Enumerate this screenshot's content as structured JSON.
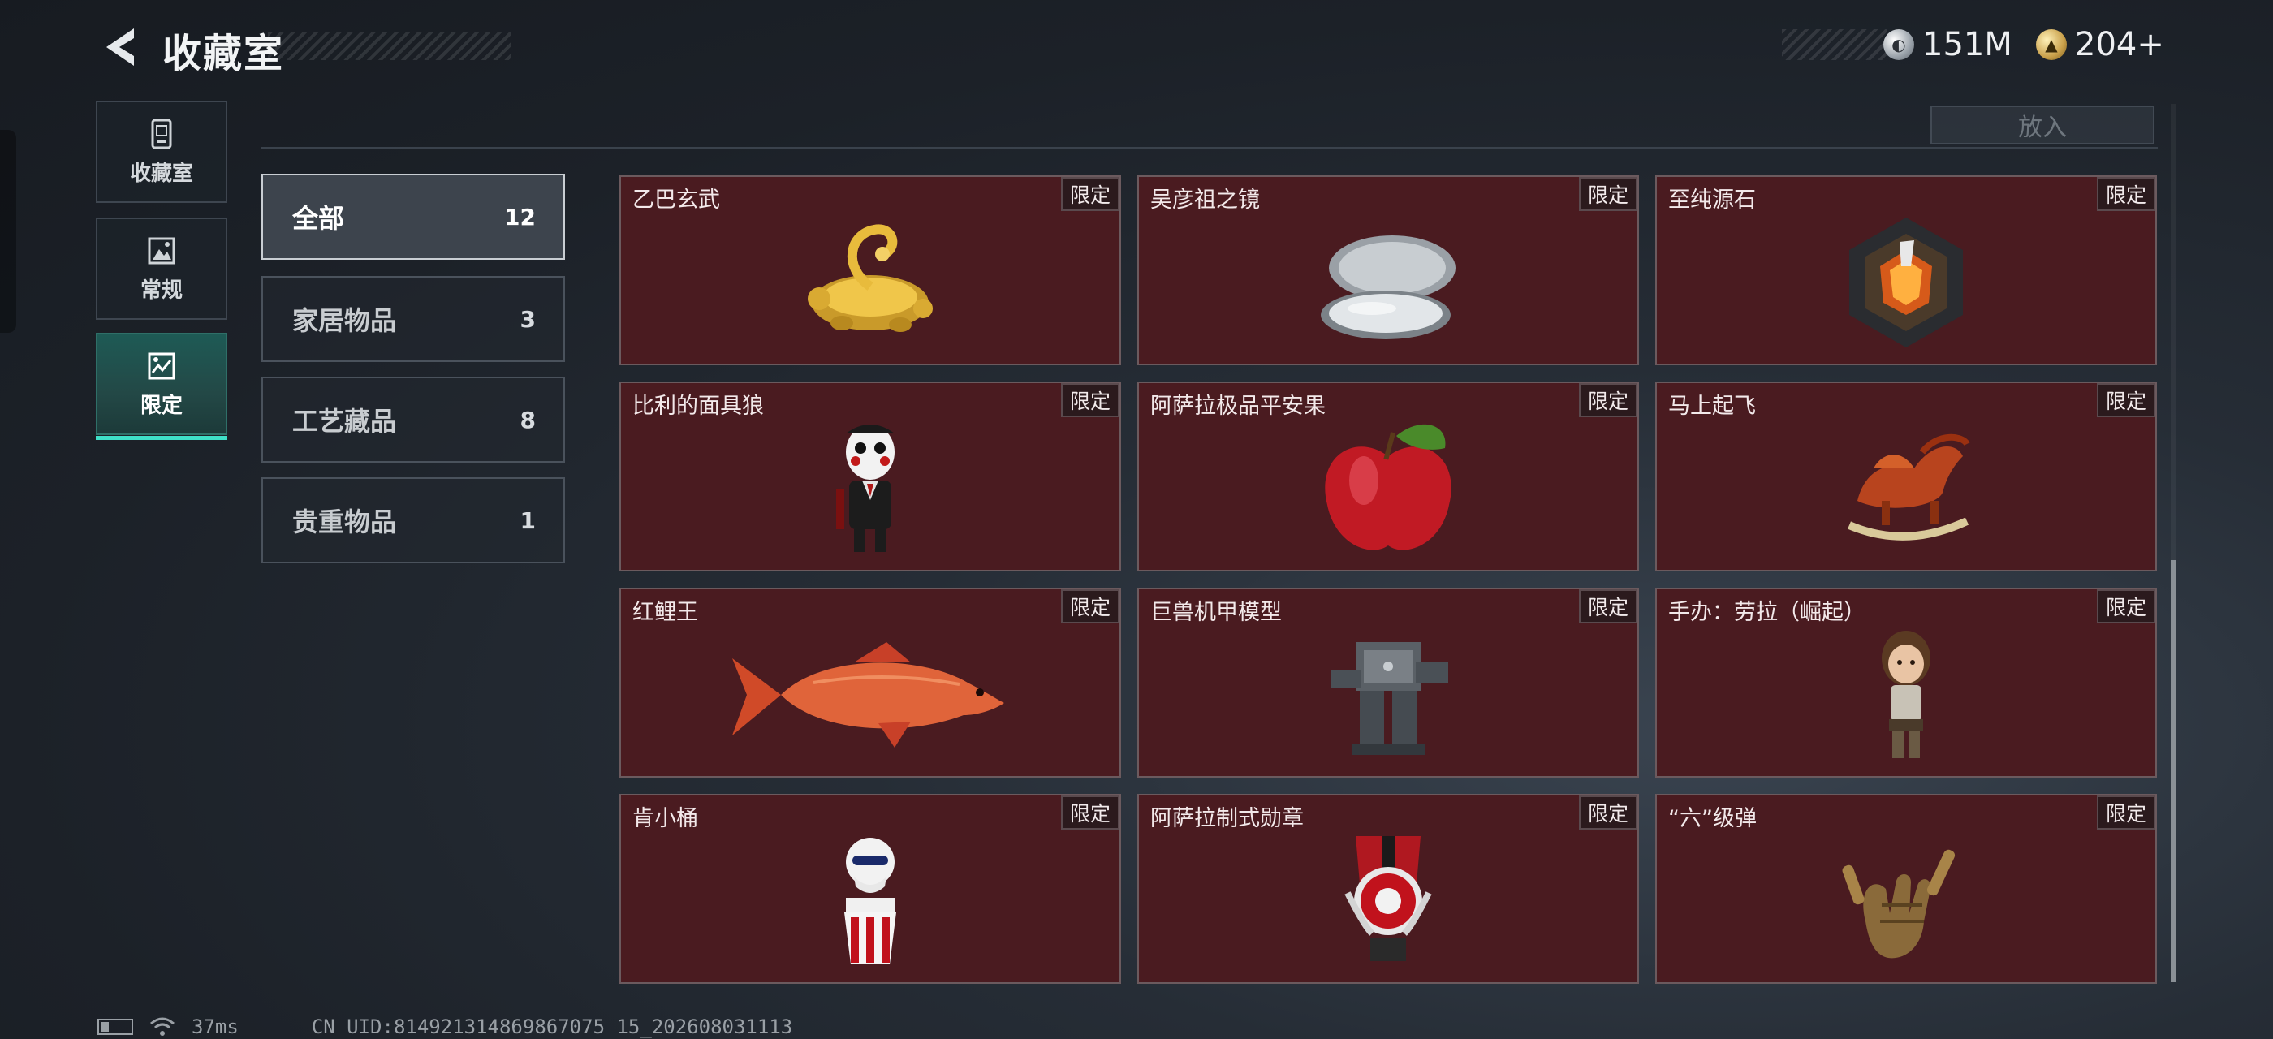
{
  "header": {
    "title": "收藏室",
    "currencies": [
      {
        "icon": "silver-coin-icon",
        "value": "151M"
      },
      {
        "icon": "gold-coin-icon",
        "value": "204+"
      }
    ]
  },
  "sidebar": {
    "tabs": [
      {
        "label": "收藏室",
        "icon": "collection-room-icon"
      },
      {
        "label": "常规",
        "icon": "regular-image-icon"
      },
      {
        "label": "限定",
        "icon": "limited-image-icon",
        "active": true
      }
    ]
  },
  "toolbar": {
    "put_label": "放入"
  },
  "categories": [
    {
      "name": "全部",
      "count": "12",
      "active": true
    },
    {
      "name": "家居物品",
      "count": "3"
    },
    {
      "name": "工艺藏品",
      "count": "8"
    },
    {
      "name": "贵重物品",
      "count": "1"
    }
  ],
  "items": [
    {
      "name": "乙巴玄武",
      "badge": "限定",
      "icon": "golden-turtle-snake-icon"
    },
    {
      "name": "吴彦祖之镜",
      "badge": "限定",
      "icon": "compact-mirror-icon"
    },
    {
      "name": "至纯源石",
      "badge": "限定",
      "icon": "source-stone-crystal-icon"
    },
    {
      "name": "比利的面具狼",
      "badge": "限定",
      "icon": "puppet-figure-icon"
    },
    {
      "name": "阿萨拉极品平安果",
      "badge": "限定",
      "icon": "red-apple-icon"
    },
    {
      "name": "马上起飞",
      "badge": "限定",
      "icon": "rocking-horse-icon"
    },
    {
      "name": "红鲤王",
      "badge": "限定",
      "icon": "red-carp-icon"
    },
    {
      "name": "巨兽机甲模型",
      "badge": "限定",
      "icon": "mech-model-icon"
    },
    {
      "name": "手办：劳拉（崛起）",
      "badge": "限定",
      "icon": "lara-figure-icon"
    },
    {
      "name": "肯小桶",
      "badge": "限定",
      "icon": "kfc-bucket-figure-icon"
    },
    {
      "name": "阿萨拉制式勋章",
      "badge": "限定",
      "icon": "medal-icon"
    },
    {
      "name": "“六”级弹",
      "badge": "限定",
      "icon": "hand-gesture-bullets-icon"
    }
  ],
  "footer": {
    "ping": "37ms",
    "uid": "CN UID:814921314869867075 15_202608031113"
  },
  "colors": {
    "card_bg": "#4a1b20",
    "active_accent": "#3fe0c8"
  }
}
